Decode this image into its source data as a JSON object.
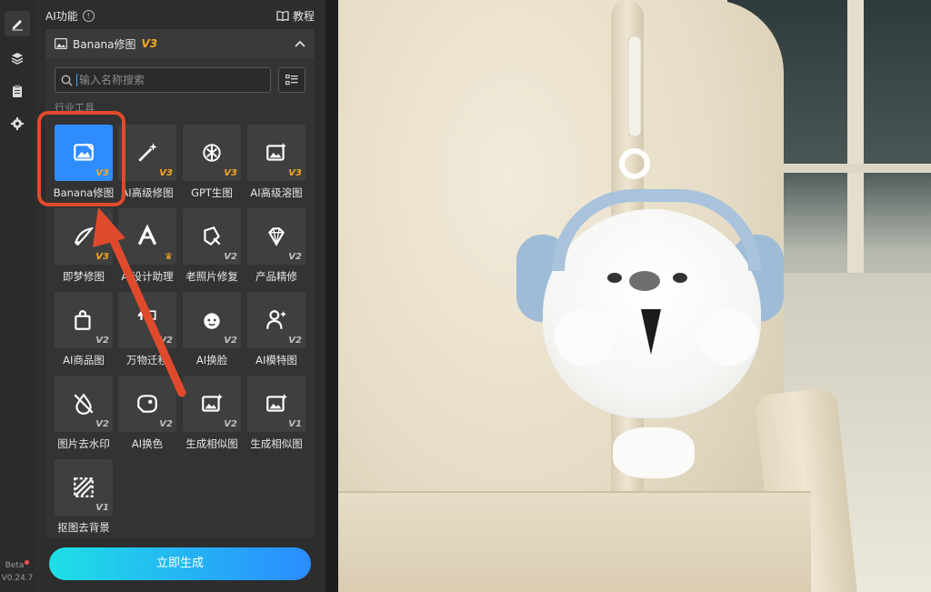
{
  "rail": {
    "beta_label": "Beta",
    "version": "V0.24.7"
  },
  "panel": {
    "title": "AI功能",
    "tutorial_label": "教程",
    "section": {
      "title": "Banana修图",
      "version": "V3"
    },
    "search": {
      "placeholder": "输入名称搜索"
    },
    "category_label": "行业工具",
    "tools": [
      {
        "label": "Banana修图",
        "badge": "V3",
        "icon": "image-edit-icon"
      },
      {
        "label": "AI高级修图",
        "badge": "V3",
        "icon": "magic-wand-icon"
      },
      {
        "label": "GPT生图",
        "badge": "V3",
        "icon": "gpt-logo-icon"
      },
      {
        "label": "AI高级溶图",
        "badge": "V3",
        "icon": "image-sparkle-icon"
      },
      {
        "label": "即梦修图",
        "badge": "V3",
        "icon": "dream-brush-icon"
      },
      {
        "label": "AI设计助理",
        "badge": "",
        "icon": "design-assistant-icon"
      },
      {
        "label": "老照片修复",
        "badge": "V2",
        "icon": "photo-repair-icon"
      },
      {
        "label": "产品精修",
        "badge": "V2",
        "icon": "gem-icon"
      },
      {
        "label": "AI商品图",
        "badge": "V2",
        "icon": "shopping-bag-icon"
      },
      {
        "label": "万物迁移",
        "badge": "V2",
        "icon": "transfer-icon"
      },
      {
        "label": "AI换脸",
        "badge": "V2",
        "icon": "face-swap-icon"
      },
      {
        "label": "AI模特图",
        "badge": "V2",
        "icon": "model-icon"
      },
      {
        "label": "图片去水印",
        "badge": "V2",
        "icon": "remove-watermark-icon"
      },
      {
        "label": "AI换色",
        "badge": "V2",
        "icon": "recolor-icon"
      },
      {
        "label": "生成相似图",
        "badge": "V2",
        "icon": "similar-image-icon"
      },
      {
        "label": "生成相似图",
        "badge": "V1",
        "icon": "similar-image-icon"
      },
      {
        "label": "抠图去背景",
        "badge": "V1",
        "icon": "cutout-icon"
      }
    ],
    "generate_label": "立即生成"
  },
  "colors": {
    "accent_orange": "#f5a623",
    "selected_blue": "#2f8cff",
    "highlight_red": "#e04a2c"
  }
}
